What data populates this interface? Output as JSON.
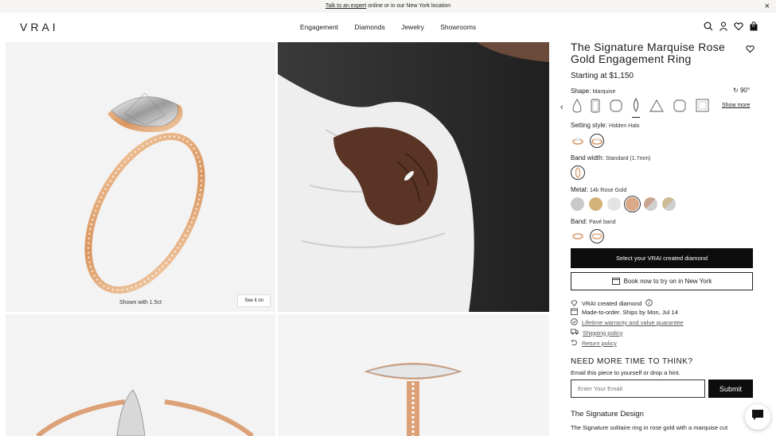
{
  "banner": {
    "link_text": "Talk to an expert",
    "rest_text": " online or in our New York location",
    "close": "×"
  },
  "header": {
    "logo": "VRAI",
    "nav": [
      "Engagement",
      "Diamonds",
      "Jewelry",
      "Showrooms"
    ],
    "icons": [
      "search-icon",
      "account-icon",
      "wishlist-icon",
      "bag-icon"
    ],
    "bag_count": "0"
  },
  "gallery": {
    "caption": "Shown with 1.5ct",
    "see_it_on": "See it on"
  },
  "product": {
    "title": "The Signature Marquise Rose Gold Engagement Ring",
    "price": "Starting at $1,150",
    "shape_label": "Shape:",
    "shape_value": "Marquise",
    "rotate": "90°",
    "show_more": "Show more",
    "setting_label": "Setting style:",
    "setting_value": "Hidden Halo",
    "band_width_label": "Band width:",
    "band_width_value": "Standard (1.7mm)",
    "metal_label": "Metal:",
    "metal_value": "14k Rose Gold",
    "band_label": "Band:",
    "band_value": "Pavé band",
    "metals": [
      {
        "name": "platinum",
        "color": "#c9c9c9"
      },
      {
        "name": "yellow-gold",
        "color": "#d4b37a"
      },
      {
        "name": "white-gold",
        "color": "#e4e4e4"
      },
      {
        "name": "rose-gold",
        "color": "#d9a98a",
        "selected": true
      },
      {
        "name": "rose-platinum",
        "color": "#c8a48e"
      },
      {
        "name": "yellow-platinum",
        "color": "#cdbb95"
      }
    ],
    "select_button": "Select your VRAI created diamond",
    "book_button": "Book now to try on in New York"
  },
  "features": {
    "created": "VRAI created diamond",
    "made": "Made-to-order. Ships by Mon, Jul 14",
    "warranty": "Lifetime warranty and value guarantee",
    "shipping": "Shipping policy",
    "returns": "Return policy"
  },
  "hint": {
    "heading": "NEED MORE TIME TO THINK?",
    "lead": "Email this piece to yourself or drop a hint.",
    "placeholder": "Enter Your Email",
    "submit": "Submit"
  },
  "signature": {
    "heading": "The Signature Design",
    "text": "The Signature solitaire ring in rose gold with a marquise cut"
  }
}
